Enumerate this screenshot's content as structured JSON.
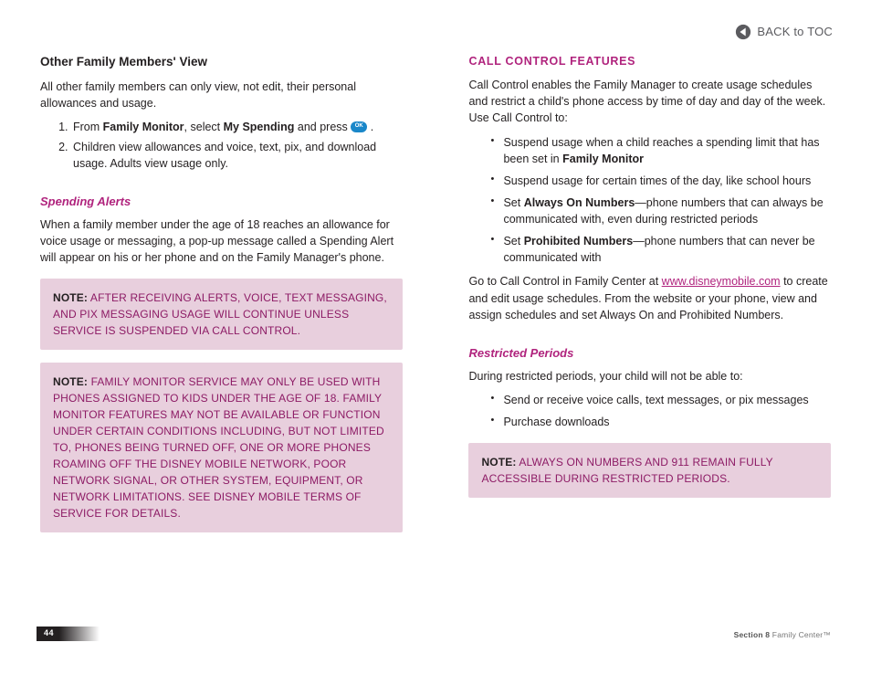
{
  "toc_label": "BACK to TOC",
  "left": {
    "h1": "Other Family Members' View",
    "p1": "All other family members can only view, not edit, their personal allowances and usage.",
    "li1_a": "From ",
    "li1_b": "Family Monitor",
    "li1_c": ", select ",
    "li1_d": "My Spending",
    "li1_e": " and press ",
    "li1_ok": "OK",
    "li1_f": " .",
    "li2": "Children view allowances and voice, text, pix, and download usage. Adults view usage only.",
    "h2": "Spending Alerts",
    "p2": "When a family member under the age of 18 reaches an allowance for voice usage or messaging, a pop-up message called a Spending Alert will appear on his or her phone and on the Family Manager's phone.",
    "note1_label": "Note:",
    "note1": " After receiving alerts, voice, text messaging, and pix messaging usage will continue unless service is suspended via Call Control.",
    "note2_label": "Note:",
    "note2": " Family Monitor service may only be used with phones assigned to kids under the age of 18. Family Monitor features may not be available or function under certain conditions including, but not limited to, phones being turned off, one or more phones roaming off the Disney Mobile network, poor network signal, or other system, equipment, or network limitations. See Disney Mobile Terms of Service for details."
  },
  "right": {
    "h1": "Call Control Features",
    "p1": "Call Control enables the Family Manager to create usage schedules and restrict a child's phone access by time of day and day of the week. Use Call Control to:",
    "b1_a": "Suspend usage when a child reaches a spending limit that has been set in ",
    "b1_b": "Family Monitor",
    "b2": "Suspend usage for certain times of the day, like school hours",
    "b3_a": "Set ",
    "b3_b": "Always On Numbers",
    "b3_c": "—phone numbers that can always be communicated with, even during restricted periods",
    "b4_a": "Set ",
    "b4_b": "Prohibited Numbers",
    "b4_c": "—phone numbers that can never be communicated with",
    "p2_a": "Go to Call Control in Family Center at ",
    "p2_link": "www.disneymobile.com",
    "p2_b": " to create and edit usage schedules. From the website or your phone, view and assign schedules and set Always On and Prohibited Numbers.",
    "h2": "Restricted Periods",
    "p3": "During restricted periods, your child will not be able to:",
    "rb1": "Send or receive voice calls, text messages, or pix messages",
    "rb2": "Purchase downloads",
    "note_label": "Note:",
    "note": " Always On Numbers and 911 remain fully accessible during restricted periods."
  },
  "footer": {
    "page": "44",
    "section_a": "Section 8",
    "section_b": " Family Center™"
  }
}
